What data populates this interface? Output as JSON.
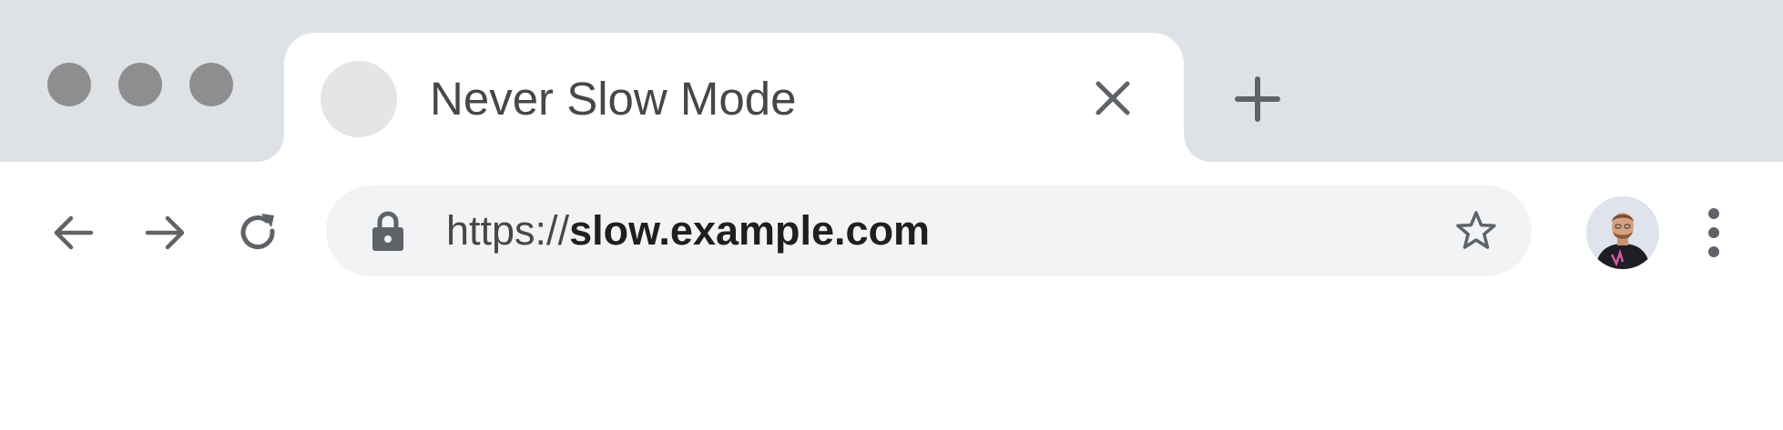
{
  "window": {
    "traffic_light_color": "#8e8e8e",
    "tabstrip_color": "#dee1e6"
  },
  "tab": {
    "title": "Never Slow Mode",
    "favicon": "blank-circle-favicon",
    "close_icon": "close-icon"
  },
  "toolbar": {
    "back_icon": "arrow-left-icon",
    "forward_icon": "arrow-right-icon",
    "reload_icon": "reload-icon",
    "new_tab_icon": "plus-icon",
    "menu_icon": "vertical-dots-icon"
  },
  "omnibox": {
    "url_scheme": "https://",
    "url_host": "slow.example.com",
    "security_icon": "lock-icon",
    "bookmark_icon": "star-outline-icon",
    "background_color": "#f1f3f4"
  },
  "profile": {
    "avatar": "profile-avatar"
  }
}
